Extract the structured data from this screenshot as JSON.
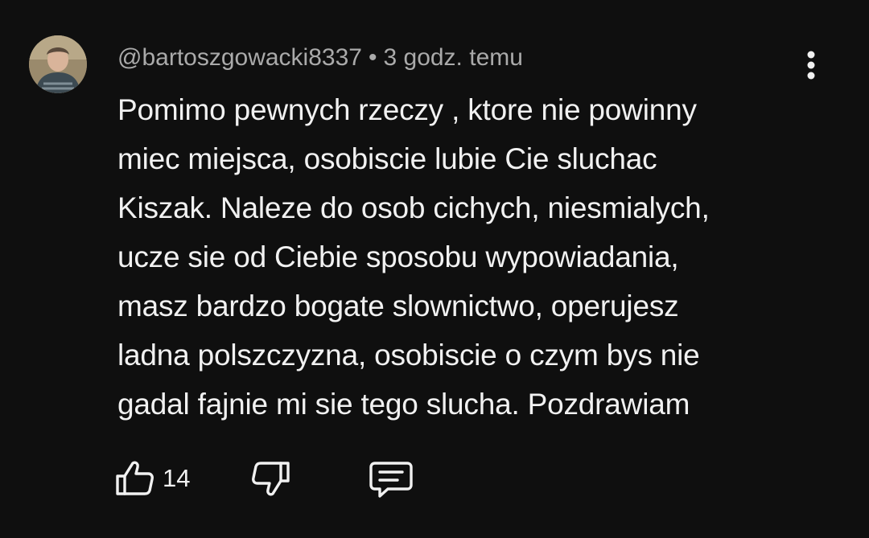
{
  "comment": {
    "author": "@bartoszgowacki8337",
    "separator": "•",
    "time": "3 godz. temu",
    "lines": [
      "Pomimo pewnych rzeczy , ktore nie powinny",
      "miec miejsca, osobiscie lubie Cie sluchac",
      "Kiszak.  Naleze do osob cichych, niesmialych,",
      "ucze sie od Ciebie sposobu wypowiadania,",
      "masz bardzo bogate slownictwo, operujesz",
      "ladna polszczyzna, osobiscie o czym bys nie",
      "gadal fajnie mi sie tego slucha. Pozdrawiam"
    ],
    "like_count": "14"
  },
  "icons": {
    "more": "more-vert-icon",
    "like": "thumb-up-icon",
    "dislike": "thumb-down-icon",
    "reply": "comment-icon"
  },
  "colors": {
    "background": "#0f0f0f",
    "text": "#f1f1f1",
    "meta": "#aaaaaa"
  }
}
